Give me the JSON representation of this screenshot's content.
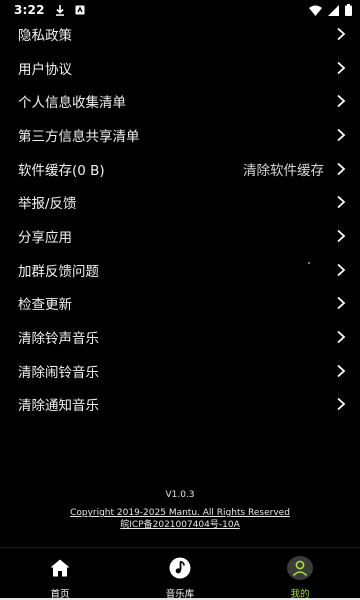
{
  "status_bar": {
    "time": "3:22",
    "icons": [
      "download-icon",
      "notification-icon",
      "wifi-icon",
      "signal-icon",
      "battery-icon"
    ]
  },
  "settings": {
    "items": [
      {
        "label": "隐私政策"
      },
      {
        "label": "用户协议"
      },
      {
        "label": "个人信息收集清单"
      },
      {
        "label": "第三方信息共享清单"
      },
      {
        "label": "软件缓存(0 B)",
        "value": "清除软件缓存"
      },
      {
        "label": "举报/反馈"
      },
      {
        "label": "分享应用"
      },
      {
        "label": "加群反馈问题"
      },
      {
        "label": "检查更新"
      },
      {
        "label": "清除铃声音乐"
      },
      {
        "label": "清除闹铃音乐"
      },
      {
        "label": "清除通知音乐"
      }
    ]
  },
  "footer": {
    "version": "V1.0.3",
    "copyright": "Copyright  2019-2025 Mantu. All Rights Reserved",
    "icp": "皖ICP备2021007404号-10A"
  },
  "bottom_nav": {
    "items": [
      {
        "label": "首页",
        "icon": "home-icon"
      },
      {
        "label": "音乐库",
        "icon": "music-library-icon"
      },
      {
        "label": "我的",
        "icon": "profile-icon",
        "active": true
      }
    ]
  },
  "colors": {
    "background": "#000000",
    "text": "#ffffff",
    "active_accent": "#a6e22e"
  }
}
